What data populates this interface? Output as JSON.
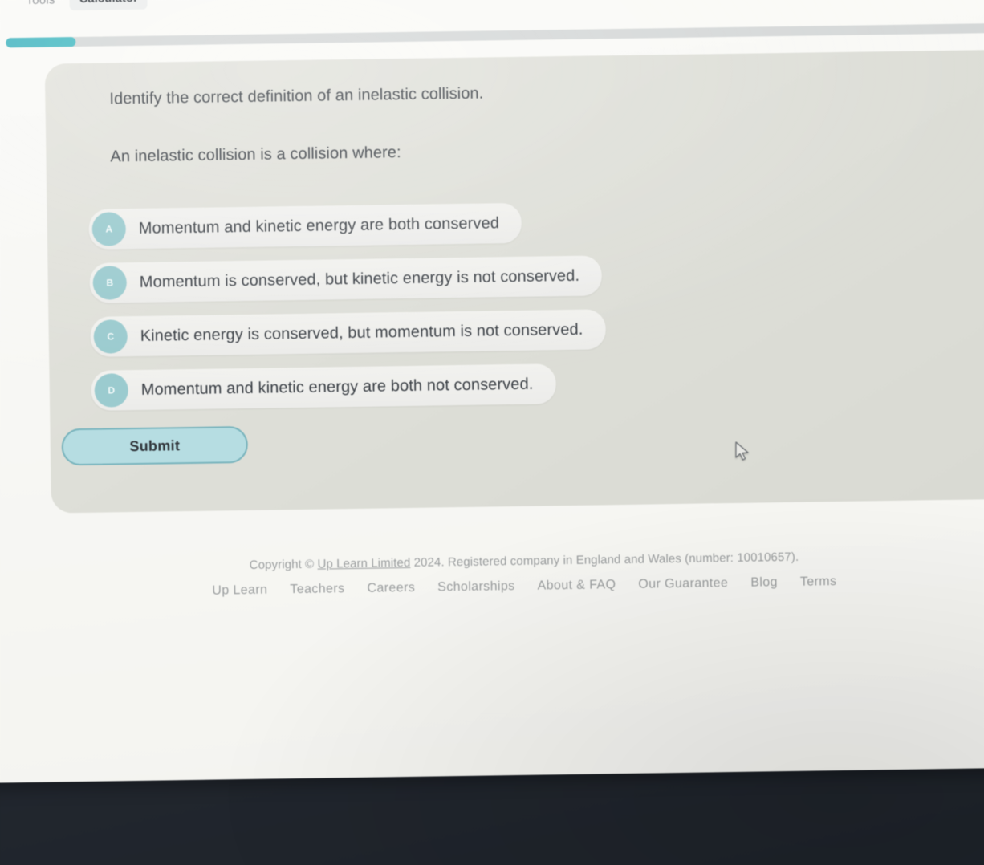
{
  "toolbar": {
    "tools_label": "Tools",
    "calculator_label": "Calculator"
  },
  "progress": {
    "percent": 7
  },
  "question": {
    "title": "Identify the correct definition of an inelastic collision.",
    "stem": "An inelastic collision is a collision where:",
    "options": [
      {
        "letter": "A",
        "text": "Momentum and kinetic energy are both conserved"
      },
      {
        "letter": "B",
        "text": "Momentum is conserved, but kinetic energy is not conserved."
      },
      {
        "letter": "C",
        "text": "Kinetic energy is conserved, but momentum is not conserved."
      },
      {
        "letter": "D",
        "text": "Momentum and kinetic energy are both not conserved."
      }
    ],
    "submit_label": "Submit"
  },
  "footer": {
    "copyright_prefix": "Copyright © ",
    "brand": "Up Learn Limited",
    "copyright_suffix": " 2024. Registered company in England and Wales (number: 10010657). ",
    "links": [
      "Up Learn",
      "Teachers",
      "Careers",
      "Scholarships",
      "About & FAQ",
      "Our Guarantee",
      "Blog",
      "Terms"
    ]
  },
  "colors": {
    "accent_teal": "#49b7c2",
    "badge_teal": "#9bcbcf",
    "submit_fill": "#b6dde2",
    "submit_border": "#79b4bd",
    "card_bg": "#e0e1da",
    "option_bg": "#f0f0ed",
    "page_bg": "#f9f9f6",
    "desk_bg": "#23282f",
    "text_dark": "#3a3f45",
    "text_muted": "#9b9e9f"
  }
}
